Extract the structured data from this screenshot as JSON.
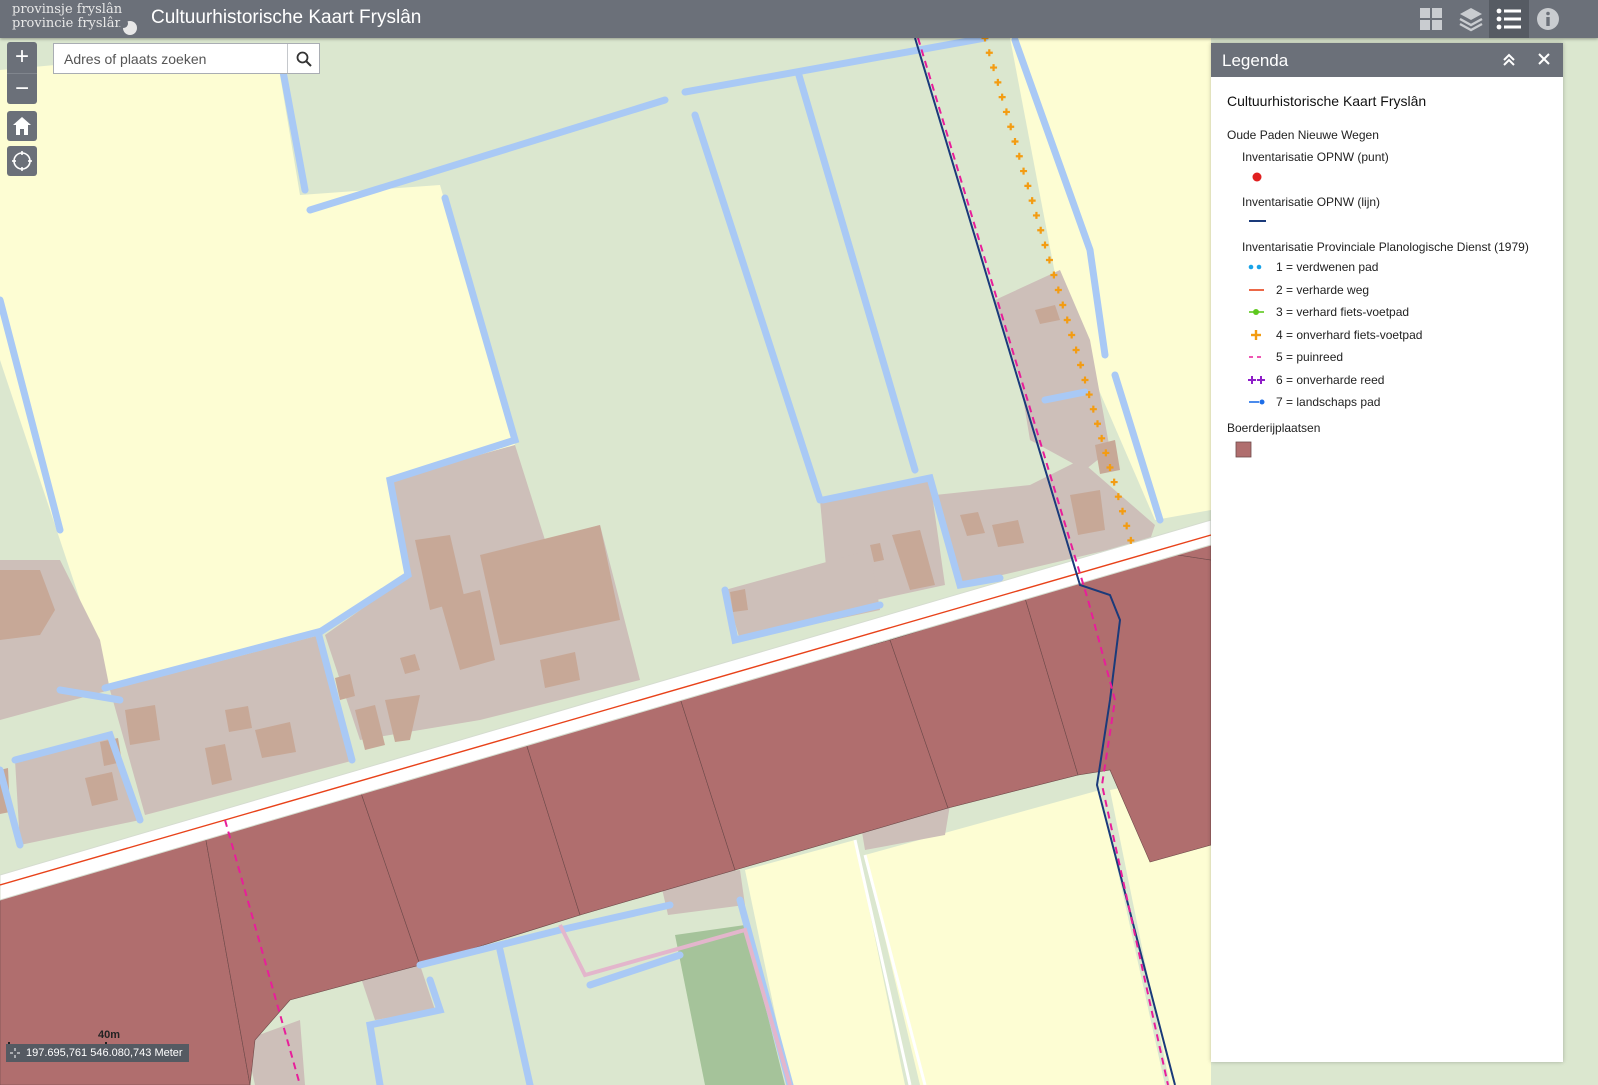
{
  "header": {
    "logo_line1": "provinsje fryslân",
    "logo_line2": "provincie fryslân",
    "title": "Cultuurhistorische Kaart Fryslân",
    "buttons": [
      {
        "name": "widget-grid-icon"
      },
      {
        "name": "layers-icon"
      },
      {
        "name": "legend-list-icon"
      },
      {
        "name": "info-icon"
      }
    ]
  },
  "search": {
    "placeholder": "Adres of plaats zoeken"
  },
  "zoom": {
    "in": "+",
    "out": "−"
  },
  "scale": {
    "label": "40m"
  },
  "coordinates": {
    "text": "197.695,761 546.080,743 Meter"
  },
  "legend": {
    "title": "Legenda",
    "service": "Cultuurhistorische Kaart Fryslân",
    "group1": "Oude Paden Nieuwe Wegen",
    "layer_punt": "Inventarisatie OPNW (punt)",
    "layer_lijn": "Inventarisatie OPNW (lijn)",
    "layer_ppd": "Inventarisatie Provinciale Planologische Dienst (1979)",
    "classes": [
      {
        "label": "1 = verdwenen pad",
        "color": "#19a3e8"
      },
      {
        "label": "2 = verharde weg",
        "color": "#e8421a"
      },
      {
        "label": "3 = verhard fiets-voetpad",
        "color": "#5ec81e"
      },
      {
        "label": "4 = onverhard fiets-voetpad",
        "color": "#f39c12"
      },
      {
        "label": "5 = puinreed",
        "color": "#e81e9a"
      },
      {
        "label": "6 = onverharde reed",
        "color": "#8e1ec8"
      },
      {
        "label": "7 = landschaps pad",
        "color": "#1e6ee8"
      }
    ],
    "group2": "Boerderijplaatsen",
    "colors": {
      "punt": "#e02020",
      "lijn": "#1a3a7a",
      "boerderij": "#b06e6e"
    }
  },
  "map_colors": {
    "meadow": "#dbe7cf",
    "field": "#fdfdd3",
    "water": "#a9c9f5",
    "yard": "#cdbfb9",
    "building": "#c7a897",
    "farm": "#b06e6e",
    "road": "#ffffff",
    "green_dark": "#a5c39a"
  }
}
